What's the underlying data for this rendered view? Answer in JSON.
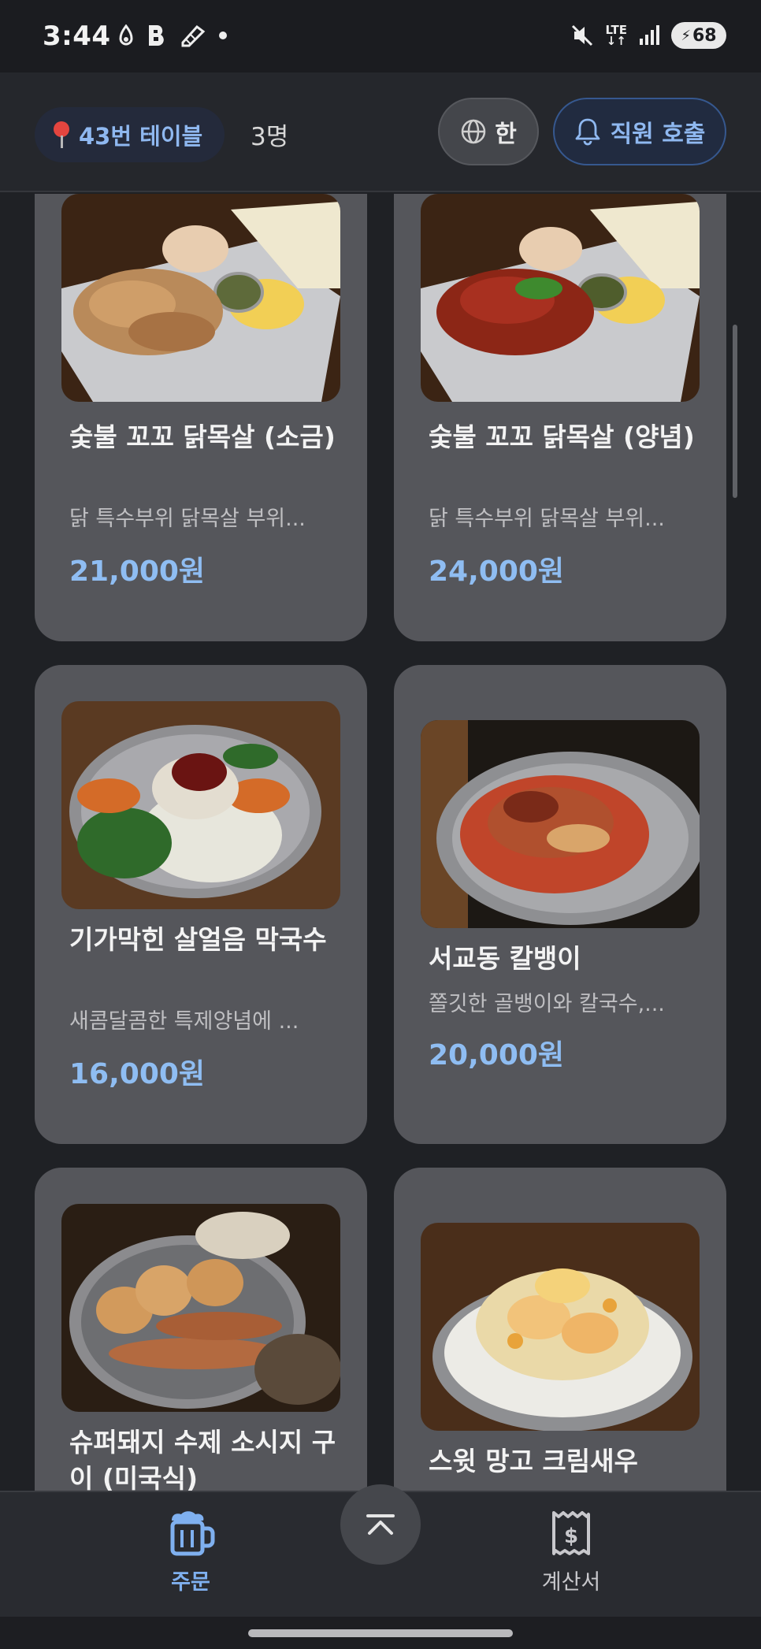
{
  "status_bar": {
    "time": "3:44",
    "network": "LTE",
    "battery": "68"
  },
  "header": {
    "table_label": "43번 테이블",
    "guest_count": "3명",
    "language_label": "한",
    "call_staff_label": "직원 호출"
  },
  "menu_items": [
    {
      "name": "숯불 꼬꼬 닭목살 (소금)",
      "description": "닭 특수부위 닭목살 부위...",
      "price": "21,000원"
    },
    {
      "name": "숯불 꼬꼬 닭목살 (양념)",
      "description": "닭 특수부위 닭목살 부위...",
      "price": "24,000원"
    },
    {
      "name": "기가막힌 살얼음 막국수",
      "description": "새콤달콤한 특제양념에 ...",
      "price": "16,000원"
    },
    {
      "name": "서교동 칼뱅이",
      "description": "쫄깃한 골뱅이와 칼국수,...",
      "price": "20,000원"
    },
    {
      "name": "슈퍼돼지 수제 소시지 구이 (미국식)",
      "description": "",
      "price": ""
    },
    {
      "name": "스윗 망고 크림새우",
      "description": "",
      "price": ""
    }
  ],
  "bottom_nav": {
    "order_label": "주문",
    "bill_label": "계산서"
  },
  "colors": {
    "accent": "#8fb8f0",
    "price": "#8fbdf2",
    "card": "#55565b",
    "background": "#1f2125"
  },
  "icons": [
    "mute-icon",
    "signal-icon",
    "pin-icon",
    "globe-icon",
    "bell-icon",
    "beer-mug-icon",
    "receipt-icon",
    "chevron-up-icon"
  ]
}
